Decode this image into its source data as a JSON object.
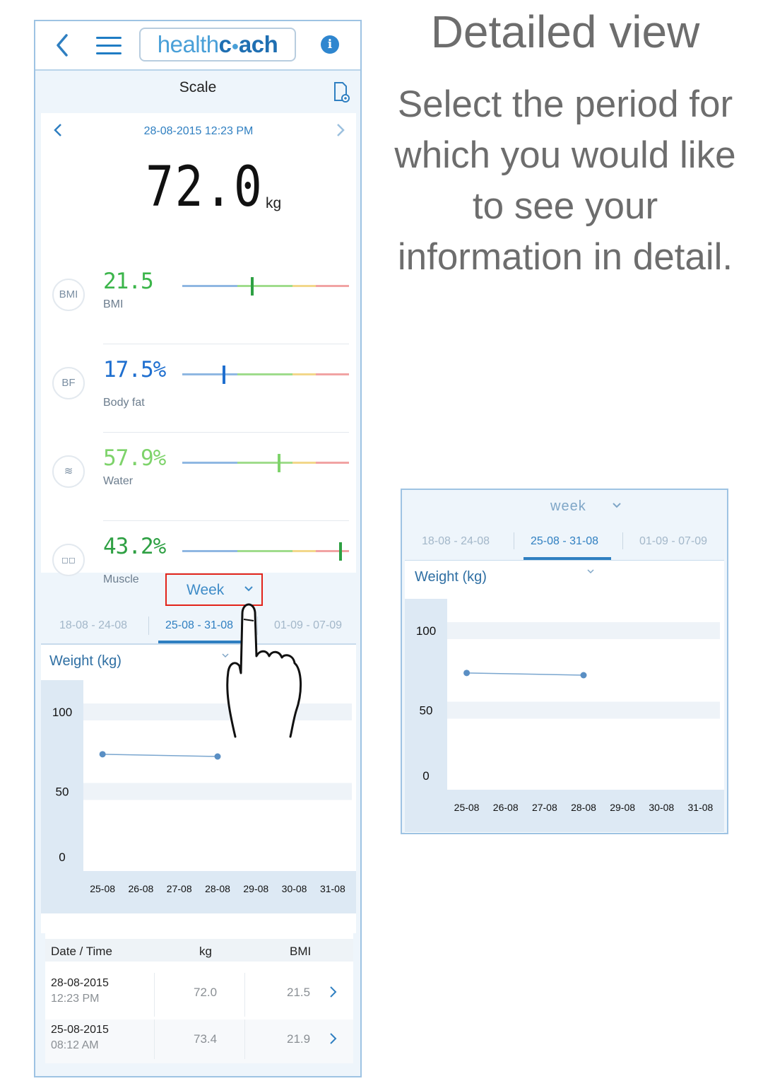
{
  "header": {
    "logo_text_a": "health",
    "logo_text_b": "c",
    "logo_text_c": "ach",
    "info_icon": "i"
  },
  "scale": {
    "title": "Scale",
    "date": "28-08-2015 12:23 PM",
    "weight": "72.0",
    "unit": "kg"
  },
  "metrics": [
    {
      "icon": "BMI",
      "value": "21.5",
      "label": "BMI",
      "color": "#3bb54a",
      "marker_color": "#2ea043",
      "level": 0.42
    },
    {
      "icon": "BF",
      "value": "17.5%",
      "label": "Body fat",
      "color": "#1f6fcf",
      "marker_color": "#1f6fcf",
      "level": 0.25
    },
    {
      "icon": "≋",
      "value": "57.9%",
      "label": "Water",
      "color": "#7ed36b",
      "marker_color": "#7ed36b",
      "level": 0.58
    },
    {
      "icon": "◻◻",
      "value": "43.2%",
      "label": "Muscle",
      "color": "#2ea043",
      "marker_color": "#2ea043",
      "level": 0.95
    }
  ],
  "period": {
    "selected": "Week",
    "tabs": [
      "18-08 - 24-08",
      "25-08 - 31-08",
      "01-09 - 07-09"
    ],
    "active_tab": 1
  },
  "chart_data": [
    {
      "type": "line",
      "title": "Weight (kg)",
      "x": [
        "25-08",
        "26-08",
        "27-08",
        "28-08",
        "29-08",
        "30-08",
        "31-08"
      ],
      "series": [
        {
          "values": [
            73.4,
            null,
            null,
            72.0,
            null,
            null,
            null
          ]
        }
      ],
      "ylim": [
        0,
        120
      ],
      "yticks": [
        0,
        50,
        100
      ]
    },
    {
      "type": "line",
      "title": "Weight (kg)",
      "x": [
        "25-08",
        "26-08",
        "27-08",
        "28-08",
        "29-08",
        "30-08",
        "31-08"
      ],
      "series": [
        {
          "values": [
            73.4,
            null,
            null,
            72.0,
            null,
            null,
            null
          ]
        }
      ],
      "ylim": [
        0,
        120
      ],
      "yticks": [
        0,
        50,
        100
      ]
    }
  ],
  "table": {
    "headers": [
      "Date / Time",
      "kg",
      "BMI"
    ],
    "rows": [
      {
        "date": "28-08-2015",
        "time": "12:23 PM",
        "kg": "72.0",
        "bmi": "21.5"
      },
      {
        "date": "25-08-2015",
        "time": "08:12 AM",
        "kg": "73.4",
        "bmi": "21.9"
      }
    ]
  },
  "info": {
    "headline": "Detailed view",
    "text": "Select the period for which you would like to see your information in detail."
  },
  "detail": {
    "period_label": "week"
  },
  "colors": {
    "accent": "#2f7fc1",
    "highlight": "#e2231a"
  }
}
